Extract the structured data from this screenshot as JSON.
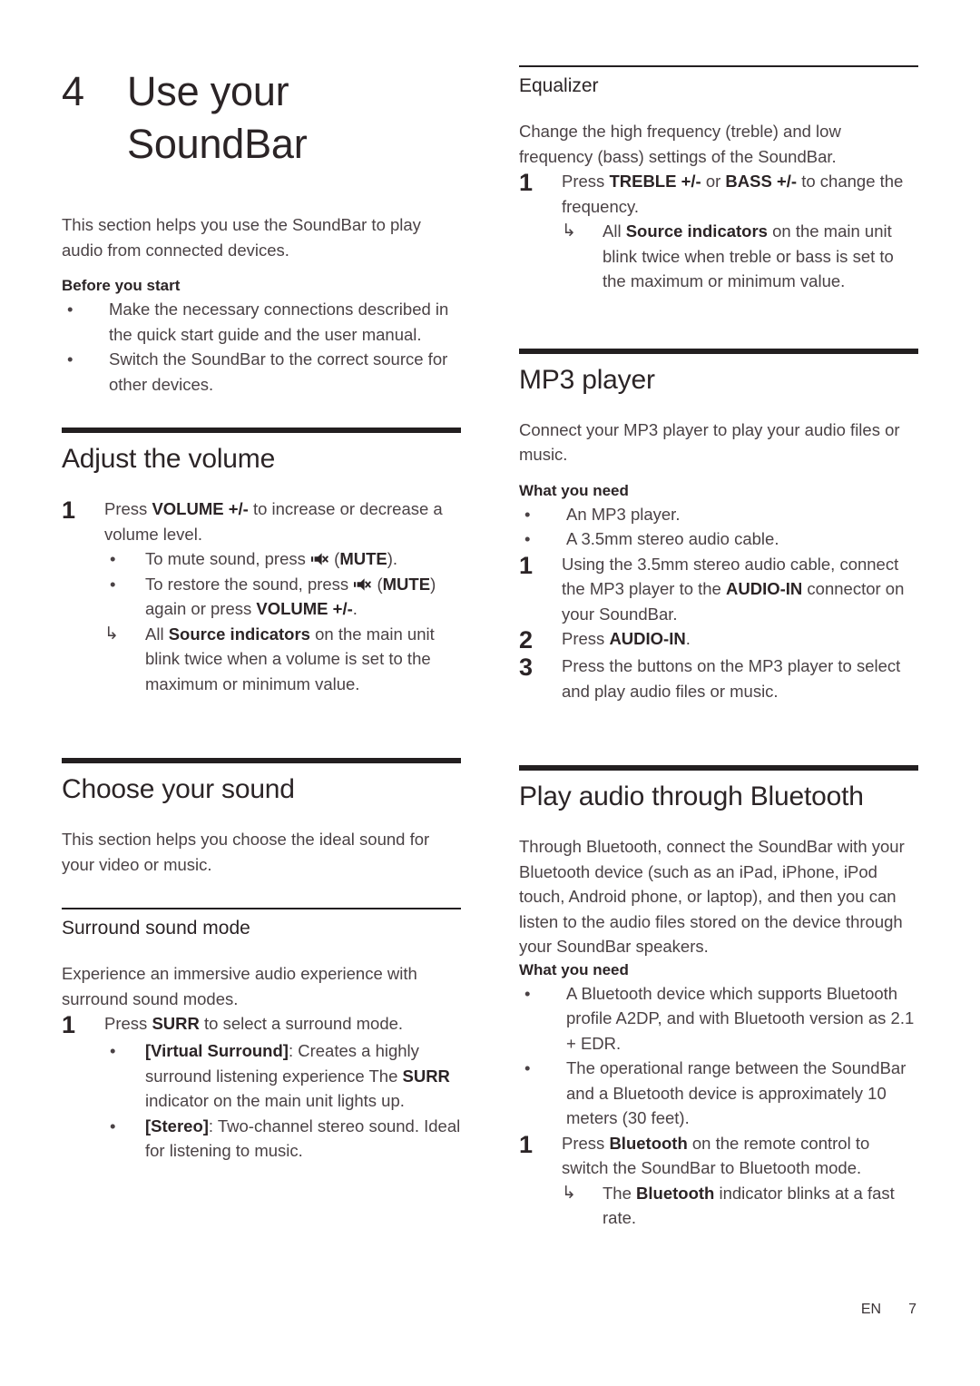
{
  "chapter": {
    "number": "4",
    "title_line1": "Use your",
    "title_line2": "SoundBar"
  },
  "intro": {
    "paragraph": "This section helps you use the SoundBar to play audio from connected devices."
  },
  "before_you_start": {
    "heading": "Before you start",
    "items": [
      "Make the necessary connections described in the quick start guide and the user manual.",
      "Switch the SoundBar to the correct source for other devices."
    ]
  },
  "adjust_the_volume": {
    "heading": "Adjust the volume",
    "step1": {
      "number": "1",
      "text_a": "Press ",
      "bold_a": "VOLUME +/-",
      "text_b": " to increase or decrease a volume level."
    },
    "bullets": [
      {
        "text_a": "To mute sound, press ",
        "icon": "mute-icon",
        "text_b": " (",
        "bold_b": "MUTE",
        "text_c": ")."
      },
      {
        "text_a": "To restore the sound, press ",
        "icon": "mute-icon",
        "text_b": " (",
        "bold_b": "MUTE",
        "text_c": ") again or press ",
        "bold_c": "VOLUME +/-",
        "text_d": "."
      }
    ],
    "note": {
      "arrow": "↳",
      "text_a": "All ",
      "bold_a": "Source indicators",
      "text_b": " on the main unit blink twice when a volume is set to the maximum or minimum value."
    }
  },
  "choose_your_sound": {
    "heading": "Choose your sound",
    "paragraph": "This section helps you choose the ideal sound for your video or music."
  },
  "surround_sound_mode": {
    "heading": "Surround sound mode",
    "paragraph": "Experience an immersive audio experience with surround sound modes.",
    "step1": {
      "number": "1",
      "text_a": "Press ",
      "bold_a": "SURR",
      "text_b": " to select a surround mode."
    },
    "bullets": [
      {
        "bold_a": "[Virtual Surround]",
        "text_a": ": Creates a highly surround listening experience The ",
        "bold_b": "SURR",
        "text_b": " indicator on the main unit lights up."
      },
      {
        "bold_a": "[Stereo]",
        "text_a": ": Two-channel stereo sound. Ideal for listening to music."
      }
    ]
  },
  "equalizer": {
    "heading": "Equalizer",
    "paragraph": "Change the high frequency (treble) and low frequency (bass) settings of the SoundBar.",
    "step1": {
      "number": "1",
      "text_a": "Press ",
      "bold_a": "TREBLE +/-",
      "text_b": " or ",
      "bold_b": "BASS +/-",
      "text_c": " to change the frequency."
    },
    "note": {
      "arrow": "↳",
      "text_a": "All ",
      "bold_a": "Source indicators",
      "text_b": " on the main unit blink twice when treble or bass is set to the maximum or minimum value."
    }
  },
  "mp3_player": {
    "heading": "MP3 player",
    "paragraph": "Connect your MP3 player to play your audio files or music.",
    "what_you_need": {
      "heading": "What you need",
      "items": [
        "An MP3 player.",
        "A 3.5mm stereo audio cable."
      ]
    },
    "steps": [
      {
        "number": "1",
        "text_a": "Using the 3.5mm stereo audio cable, connect the MP3 player to the ",
        "bold_a": "AUDIO-IN",
        "text_b": " connector on your SoundBar."
      },
      {
        "number": "2",
        "text_a": "Press ",
        "bold_a": "AUDIO-IN",
        "text_b": "."
      },
      {
        "number": "3",
        "text_a": "Press the buttons on the MP3 player to select and play audio files or music."
      }
    ]
  },
  "play_audio_through_bluetooth": {
    "heading": "Play audio through Bluetooth",
    "paragraph": "Through Bluetooth, connect the SoundBar with your Bluetooth device (such as an iPad, iPhone, iPod touch, Android phone, or laptop), and then you can listen to the audio files stored on the device through your SoundBar speakers.",
    "what_you_need": {
      "heading": "What you need",
      "items": [
        "A Bluetooth device which supports Bluetooth profile A2DP, and with Bluetooth version as 2.1 + EDR.",
        "The operational range between the SoundBar and a Bluetooth device is approximately 10 meters (30 feet)."
      ]
    },
    "step1": {
      "number": "1",
      "text_a": "Press ",
      "bold_a": "Bluetooth",
      "text_b": " on the remote control to switch the SoundBar to Bluetooth mode."
    },
    "note": {
      "arrow": "↳",
      "text_a": "The ",
      "bold_a": "Bluetooth",
      "text_b": " indicator blinks at a fast rate."
    }
  },
  "footer": {
    "language": "EN",
    "page_number": "7"
  },
  "colors": {
    "rule": "#231f20",
    "heading": "#2b2426",
    "body": "#4a4245"
  }
}
